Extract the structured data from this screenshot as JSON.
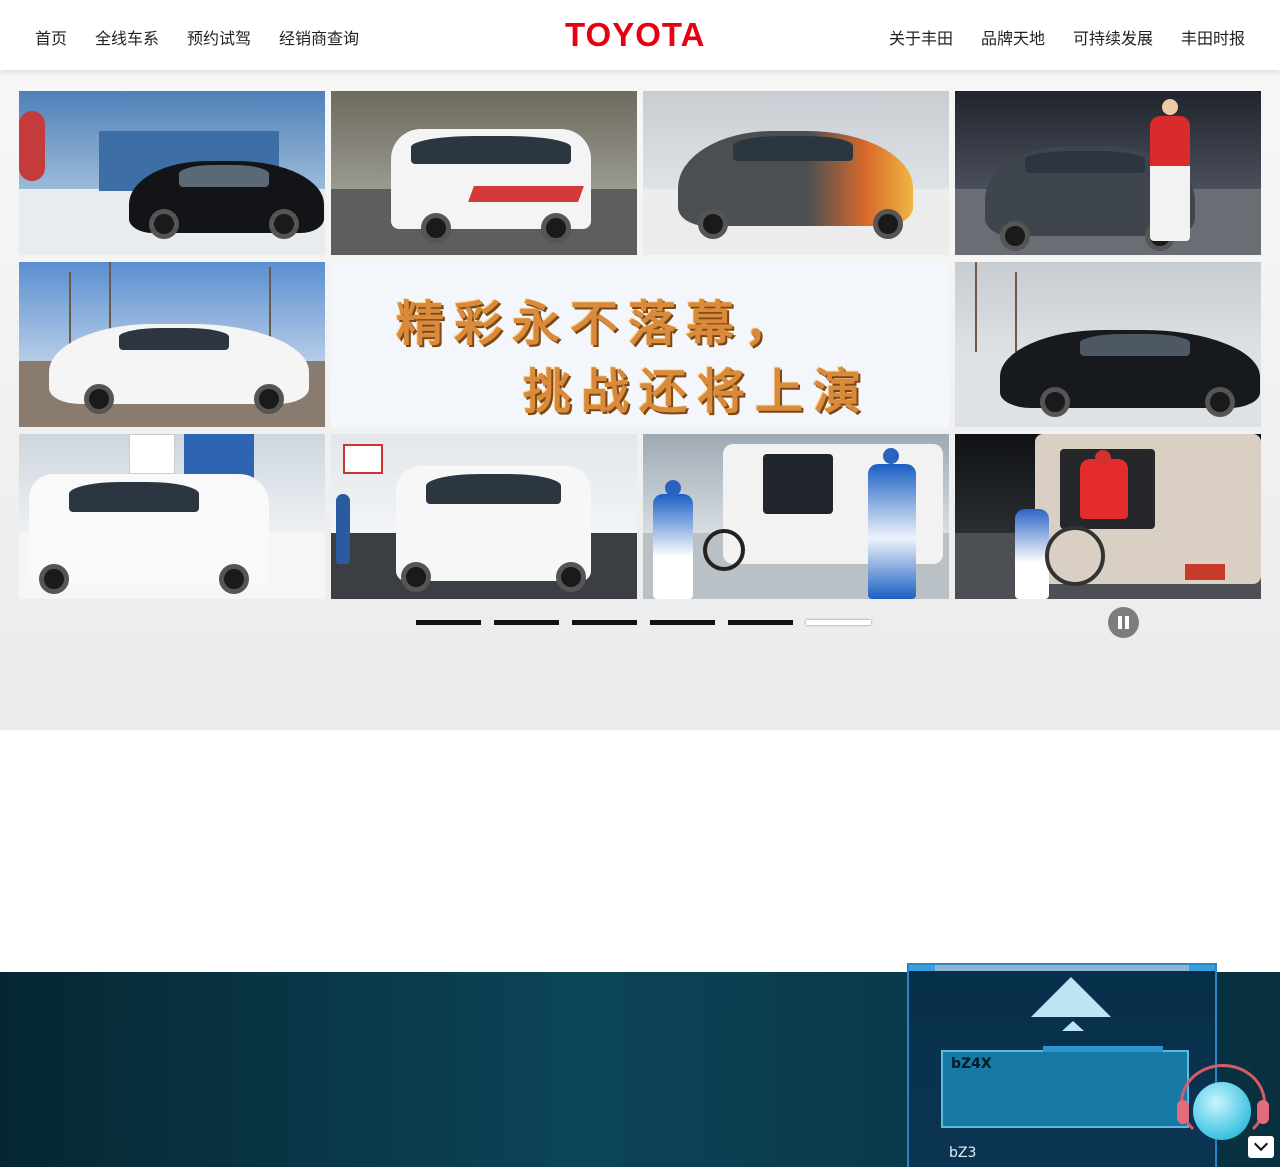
{
  "header": {
    "nav_left": [
      "首页",
      "全线车系",
      "预约试驾",
      "经销商查询"
    ],
    "logo": "TOYOTA",
    "nav_right": [
      "关于丰田",
      "品牌天地",
      "可持续发展",
      "丰田时报"
    ]
  },
  "hero": {
    "slogan_line1": "精彩永不落幕，",
    "slogan_line2": "挑战还将上演",
    "carousel_slides": 6,
    "carousel_active_index": 5
  },
  "model_widget": {
    "active_model": "bZ4X",
    "next_model": "bZ3"
  },
  "colors": {
    "brand_red": "#e60012",
    "bottom_band": "#0b4557",
    "widget_blue": "#1779a6"
  }
}
